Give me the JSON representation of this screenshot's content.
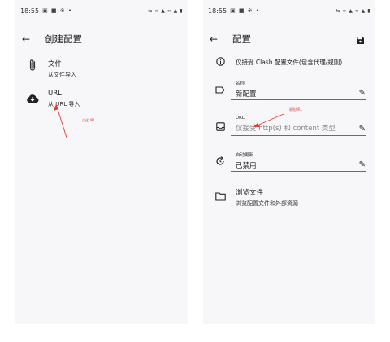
{
  "left": {
    "status": {
      "time": "18:55",
      "indicators": "▣ ■ ※ •",
      "right_indicators": "⇆ ∞ ▲ ∞ ▲ ▮"
    },
    "appbar": {
      "title": "创建配置"
    },
    "items": [
      {
        "title": "文件",
        "subtitle": "从文件导入"
      },
      {
        "title": "URL",
        "subtitle": "从 URL 导入"
      }
    ],
    "annotation": "点这URL"
  },
  "right": {
    "status": {
      "time": "18:55",
      "indicators": "▣ ■ ※ •",
      "right_indicators": "⇆ ∞ ▲ ∞ ▲ ▮"
    },
    "appbar": {
      "title": "配置"
    },
    "info": "仅接受 Clash 配置文件(包含代理/规则)",
    "name": {
      "label": "名称",
      "value": "新配置"
    },
    "url": {
      "label": "URL",
      "placeholder": "仅接受 http(s) 和 content 类型"
    },
    "auto_update": {
      "label": "自动更新",
      "value": "已禁用"
    },
    "browse": {
      "title": "浏览文件",
      "subtitle": "浏览配置文件和外部资源"
    },
    "annotation": "粘贴URL"
  },
  "colors": {
    "arrow": "#e23b3b",
    "screen_bg": "#f7f7f9"
  }
}
